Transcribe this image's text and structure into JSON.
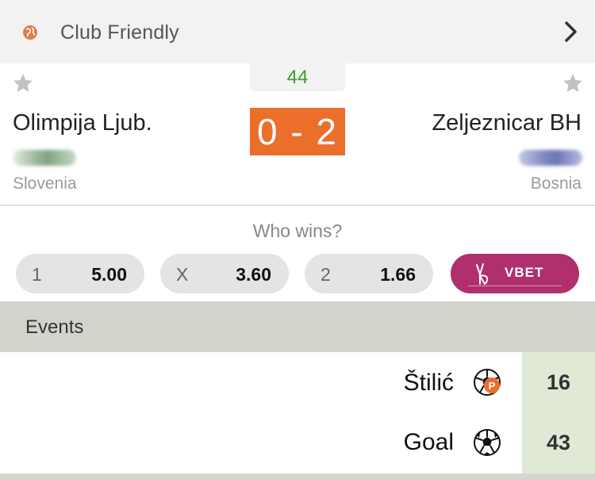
{
  "header": {
    "league_title": "Club Friendly",
    "icons": {
      "globe": "globe-icon",
      "chevron": "chevron-right-icon"
    }
  },
  "match": {
    "minute": "44",
    "score": "0 - 2",
    "home": {
      "name": "Olimpija Ljub.",
      "country": "Slovenia"
    },
    "away": {
      "name": "Zeljeznicar BH",
      "country": "Bosnia"
    },
    "accent_color": "#ec6e2b",
    "minute_color": "#3f9a2d"
  },
  "odds": {
    "title": "Who wins?",
    "options": [
      {
        "label": "1",
        "value": "5.00"
      },
      {
        "label": "X",
        "value": "3.60"
      },
      {
        "label": "2",
        "value": "1.66"
      }
    ],
    "sponsor": "VBET",
    "sponsor_color": "#b0306e"
  },
  "events": {
    "title": "Events",
    "items": [
      {
        "name": "Štilić",
        "icon": "penalty-ball-icon",
        "minute": "16"
      },
      {
        "name": "Goal",
        "icon": "soccer-ball-icon",
        "minute": "43"
      }
    ]
  }
}
